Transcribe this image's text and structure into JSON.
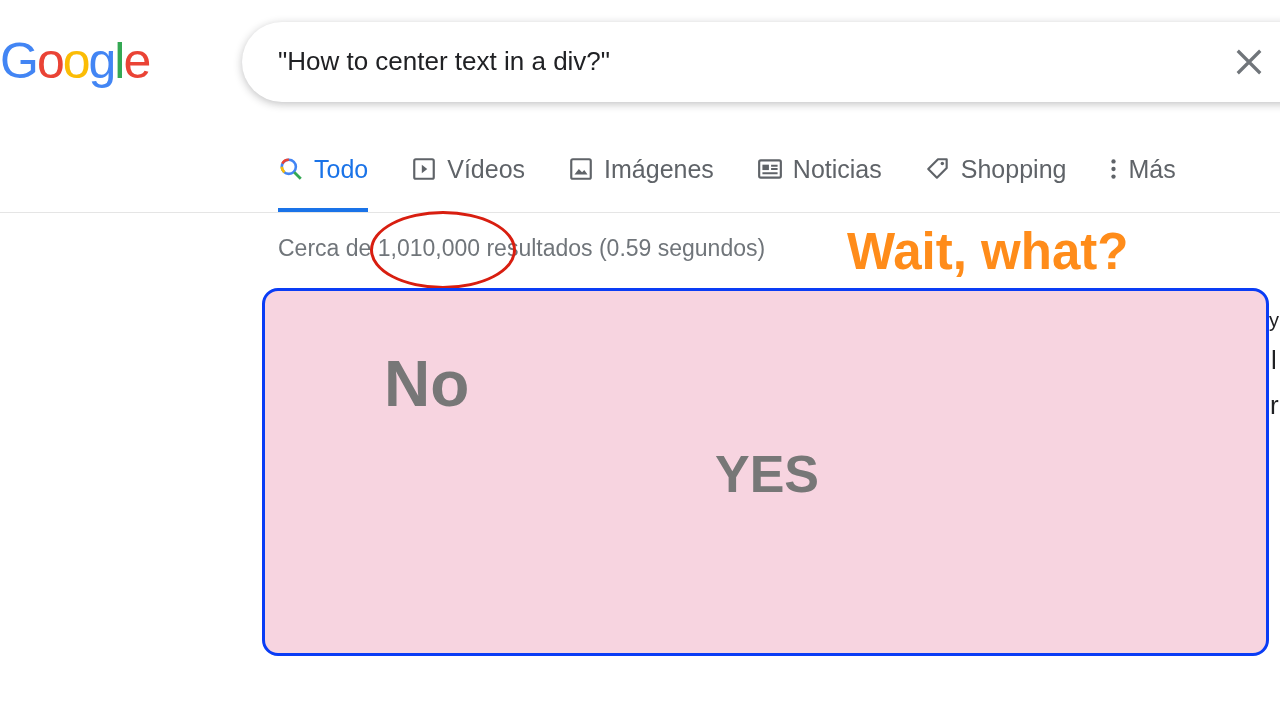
{
  "logo": "Google",
  "search": {
    "value": "\"How to center text in a div?\""
  },
  "tabs": [
    {
      "kind": "search",
      "label": "Todo",
      "selected": true
    },
    {
      "kind": "video",
      "label": "Vídeos",
      "selected": false
    },
    {
      "kind": "image",
      "label": "Imágenes",
      "selected": false
    },
    {
      "kind": "news",
      "label": "Noticias",
      "selected": false
    },
    {
      "kind": "tag",
      "label": "Shopping",
      "selected": false
    },
    {
      "kind": "more",
      "label": "Más",
      "selected": false
    }
  ],
  "results_stats": {
    "prefix": "Cerca de ",
    "count": "1,010,000",
    "suffix": " resultados (0.59 segundos)"
  },
  "annotation": "Wait, what?",
  "meme_box": {
    "text_1": "No",
    "text_2": "YES"
  },
  "clipped_text": [
    "y",
    "l",
    "r"
  ]
}
